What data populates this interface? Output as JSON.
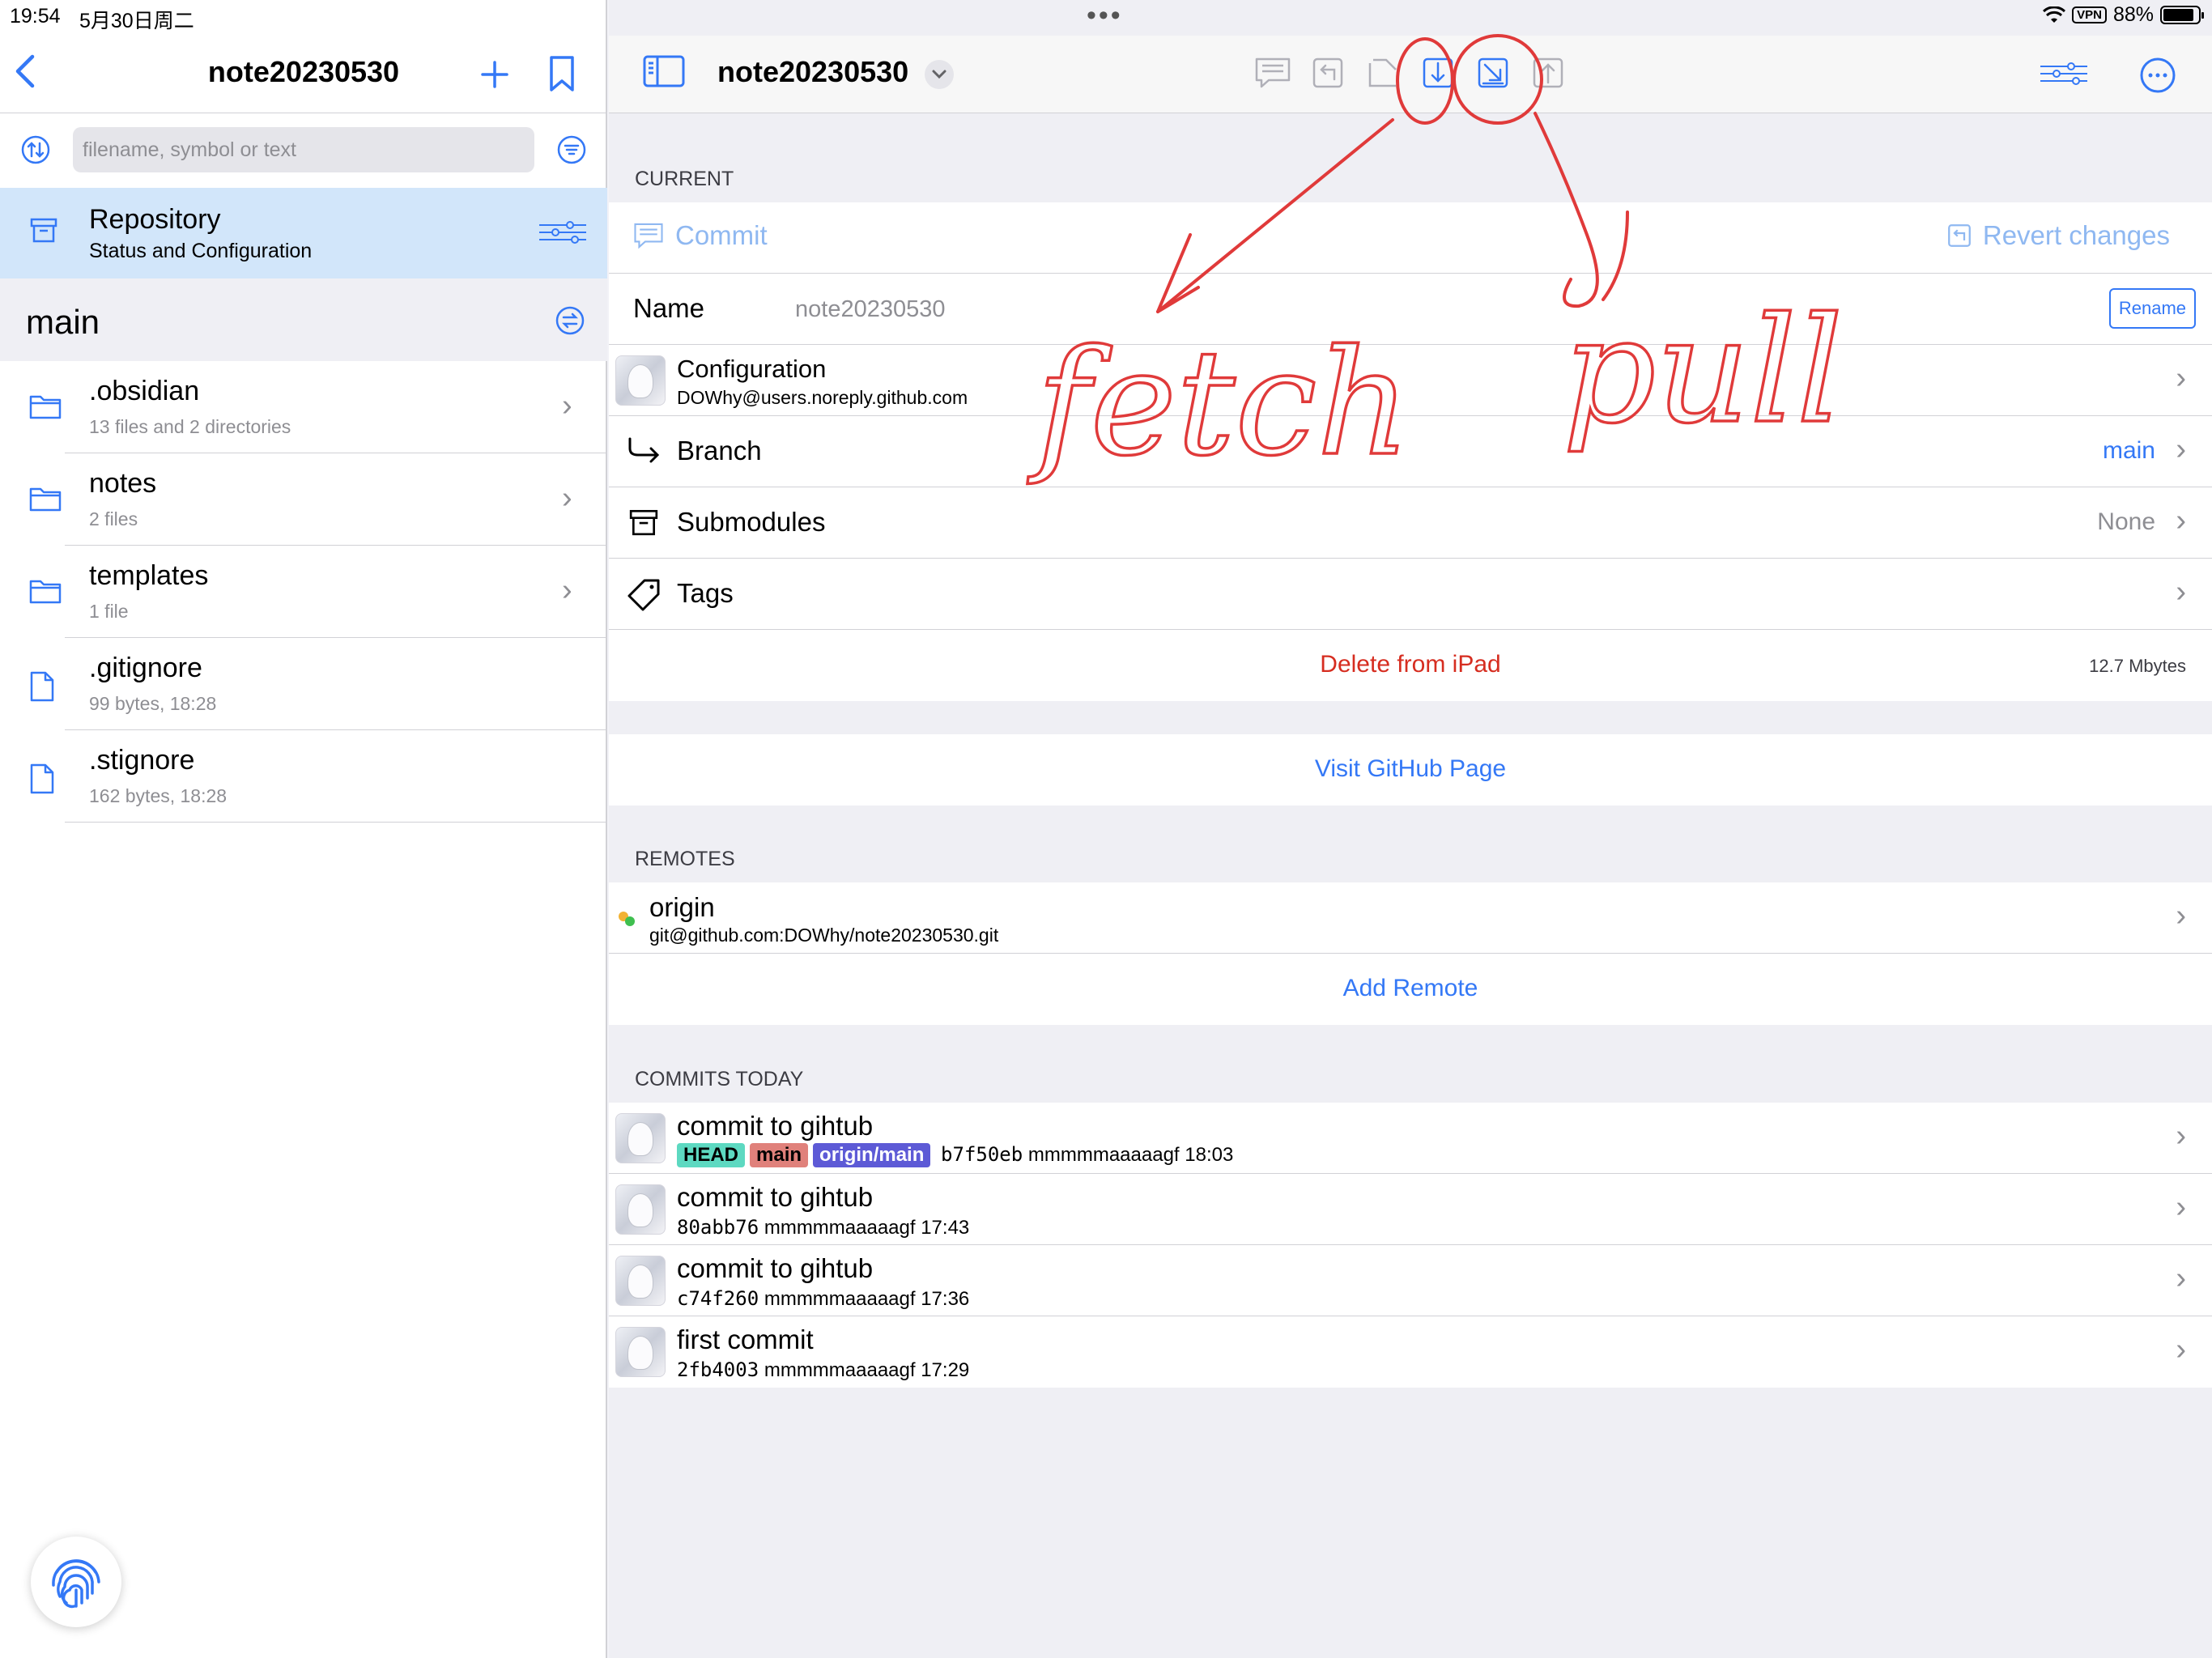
{
  "status_bar": {
    "time": "19:54",
    "date": "5月30日周二",
    "vpn": "VPN",
    "battery": "88%",
    "battery_level": 0.88
  },
  "sidebar": {
    "title": "note20230530",
    "search_placeholder": "filename, symbol or text",
    "repository": {
      "title": "Repository",
      "subtitle": "Status and Configuration"
    },
    "branch": "main",
    "files": [
      {
        "name": ".obsidian",
        "meta": "13 files and 2 directories",
        "kind": "folder",
        "has_chevron": true
      },
      {
        "name": "notes",
        "meta": "2 files",
        "kind": "folder",
        "has_chevron": true
      },
      {
        "name": "templates",
        "meta": "1 file",
        "kind": "folder",
        "has_chevron": true
      },
      {
        "name": ".gitignore",
        "meta": "99 bytes, 18:28",
        "kind": "file",
        "has_chevron": false
      },
      {
        "name": ".stignore",
        "meta": "162 bytes, 18:28",
        "kind": "file",
        "has_chevron": false
      }
    ]
  },
  "main": {
    "title": "note20230530",
    "current": {
      "section_label": "CURRENT",
      "commit_label": "Commit",
      "revert_label": "Revert changes",
      "name_label": "Name",
      "name_value": "note20230530",
      "rename_label": "Rename",
      "configuration": {
        "title": "Configuration",
        "email": "DOWhy@users.noreply.github.com"
      },
      "branch_label": "Branch",
      "branch_value": "main",
      "submodules_label": "Submodules",
      "submodules_value": "None",
      "tags_label": "Tags",
      "delete_label": "Delete from iPad",
      "size": "12.7 Mbytes"
    },
    "visit_github": "Visit GitHub Page",
    "remotes": {
      "section_label": "REMOTES",
      "items": [
        {
          "name": "origin",
          "url": "git@github.com:DOWhy/note20230530.git"
        }
      ],
      "add_label": "Add Remote"
    },
    "commits": {
      "section_label": "COMMITS TODAY",
      "items": [
        {
          "message": "commit to gihtub",
          "tags": [
            "HEAD",
            "main",
            "origin/main"
          ],
          "hash": "b7f50eb",
          "info": "mmmmmaaaaagf 18:03"
        },
        {
          "message": "commit to gihtub",
          "hash": "80abb76",
          "info": "mmmmmaaaaagf 17:43"
        },
        {
          "message": "commit to gihtub",
          "hash": "c74f260",
          "info": "mmmmmaaaaagf 17:36"
        },
        {
          "message": "first commit",
          "hash": "2fb4003",
          "info": "mmmmmaaaaagf 17:29"
        }
      ]
    }
  },
  "annotations": {
    "fetch": "fetch",
    "pull": "pull",
    "ink_color": "#e03a3a"
  },
  "colors": {
    "accent": "#3478f6",
    "danger": "#d62d20",
    "selected_row": "#d2e6fa"
  }
}
